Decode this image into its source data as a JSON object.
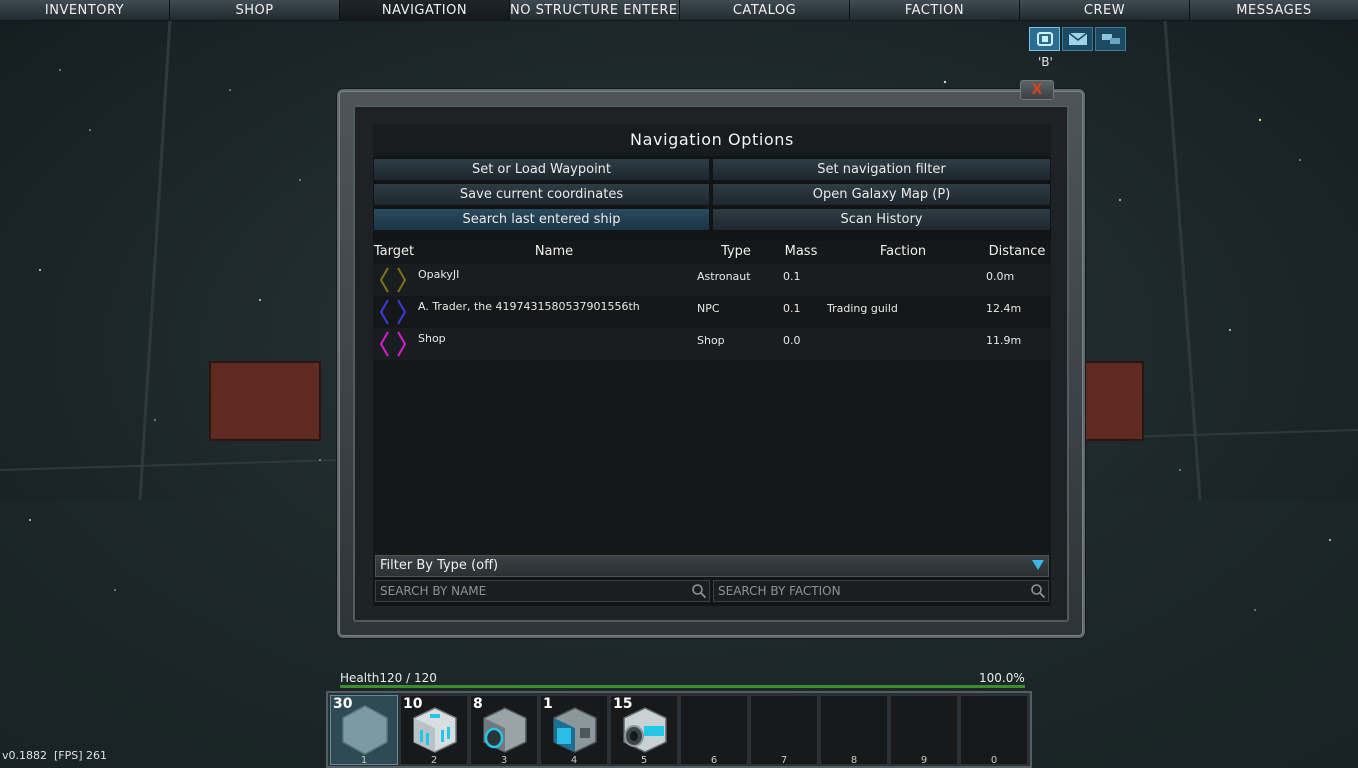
{
  "menu": {
    "tabs": [
      {
        "label": "INVENTORY",
        "icon": ""
      },
      {
        "label": "SHOP"
      },
      {
        "label": "NAVIGATION"
      },
      {
        "label": "NO STRUCTURE ENTERED"
      },
      {
        "label": "CATALOG"
      },
      {
        "label": "FACTION"
      },
      {
        "label": "CREW"
      },
      {
        "label": "MESSAGES"
      }
    ],
    "active_tab": "NAVIGATION"
  },
  "quick_icons": {
    "items": [
      "chat-icon",
      "mail-icon",
      "transfer-icon"
    ],
    "hint": "'B'"
  },
  "panel": {
    "close_label": "X",
    "title": "Navigation Options",
    "buttons": {
      "waypoint": "Set or Load Waypoint",
      "nav_filter": "Set navigation filter",
      "save_coords": "Save current coordinates",
      "galaxy_map": "Open Galaxy Map (P)",
      "search_last": "Search last entered ship",
      "scan_history": "Scan History"
    },
    "table": {
      "headers": {
        "target": "Target",
        "name": "Name",
        "type": "Type",
        "mass": "Mass",
        "faction": "Faction",
        "distance": "Distance"
      },
      "rows": [
        {
          "name": "OpakyJI",
          "type": "Astronaut",
          "mass": "0.1",
          "faction": "",
          "distance": "0.0m",
          "bracket_color": "#77741f"
        },
        {
          "name": "A. Trader, the 4197431580537901556th",
          "type": "NPC",
          "mass": "0.1",
          "faction": "Trading guild",
          "distance": "12.4m",
          "bracket_color": "#3b3bdc"
        },
        {
          "name": "Shop",
          "type": "Shop",
          "mass": "0.0",
          "faction": "",
          "distance": "11.9m",
          "bracket_color": "#d21ed2"
        }
      ]
    },
    "filter_label": "Filter By Type (off)",
    "search_name_placeholder": "SEARCH BY NAME",
    "search_faction_placeholder": "SEARCH BY FACTION"
  },
  "hud": {
    "health_label": "Health120 / 120",
    "health_percent": "100.0%",
    "health_fraction": 1.0,
    "hotbar": [
      {
        "count": "30",
        "slot": "1",
        "selected": true
      },
      {
        "count": "10",
        "slot": "2"
      },
      {
        "count": "8",
        "slot": "3"
      },
      {
        "count": "1",
        "slot": "4"
      },
      {
        "count": "15",
        "slot": "5"
      },
      {
        "count": "",
        "slot": "6"
      },
      {
        "count": "",
        "slot": "7"
      },
      {
        "count": "",
        "slot": "8"
      },
      {
        "count": "",
        "slot": "9"
      },
      {
        "count": "",
        "slot": "0"
      }
    ],
    "version": "v0.1882",
    "fps_label": "[FPS] 261"
  },
  "colors": {
    "accent": "#2b6d8e",
    "health_bar": "#3d8d2f",
    "close_x": "#d8421c"
  }
}
